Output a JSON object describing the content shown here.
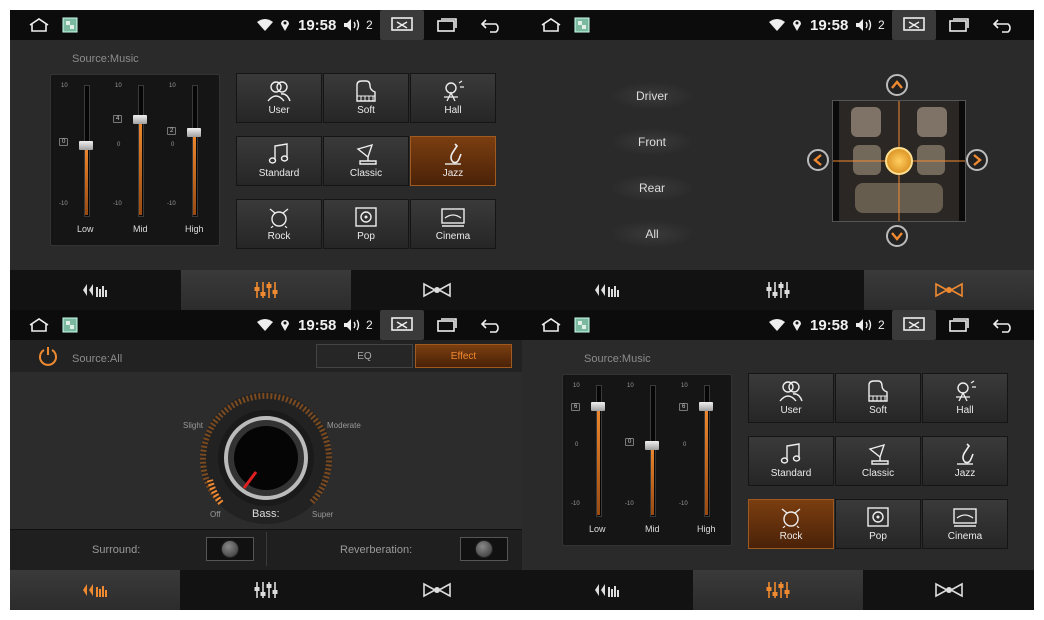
{
  "status": {
    "time": "19:58",
    "count": "2"
  },
  "colors": {
    "accent": "#f08a30",
    "active_preset": "#7b3e10"
  },
  "icons": {
    "home": "home-icon",
    "gallery": "gallery-icon",
    "wifi": "wifi-icon",
    "location": "location-icon",
    "volume": "volume-icon",
    "screen": "screen-icon",
    "recents": "recents-icon",
    "back": "back-icon"
  },
  "eq_panel_1": {
    "source": "Source:Music",
    "sliders": [
      {
        "label": "Low",
        "value": "0",
        "level": 0
      },
      {
        "label": "Mid",
        "value": "4",
        "level": 4
      },
      {
        "label": "High",
        "value": "2",
        "level": 2
      }
    ],
    "scale": [
      "10",
      "0",
      "-10"
    ],
    "presets": [
      "User",
      "Soft",
      "Hall",
      "Standard",
      "Classic",
      "Jazz",
      "Rock",
      "Pop",
      "Cinema"
    ],
    "active_preset": "Jazz"
  },
  "zone_panel": {
    "buttons": [
      "Driver",
      "Front",
      "Rear",
      "All"
    ]
  },
  "effect_panel": {
    "source": "Source:All",
    "tabs": [
      "EQ",
      "Effect"
    ],
    "active_tab": "Effect",
    "dial": {
      "slight": "Slight",
      "moderate": "Moderate",
      "off": "Off",
      "super": "Super",
      "label": "Bass:"
    },
    "surround": "Surround:",
    "reverberation": "Reverberation:"
  },
  "eq_panel_4": {
    "source": "Source:Music",
    "sliders": [
      {
        "label": "Low",
        "value": "6",
        "level": 6
      },
      {
        "label": "Mid",
        "value": "0",
        "level": 0
      },
      {
        "label": "High",
        "value": "6",
        "level": 6
      }
    ],
    "scale": [
      "10",
      "0",
      "-10"
    ],
    "presets": [
      "User",
      "Soft",
      "Hall",
      "Standard",
      "Classic",
      "Jazz",
      "Rock",
      "Pop",
      "Cinema"
    ],
    "active_preset": "Rock"
  }
}
